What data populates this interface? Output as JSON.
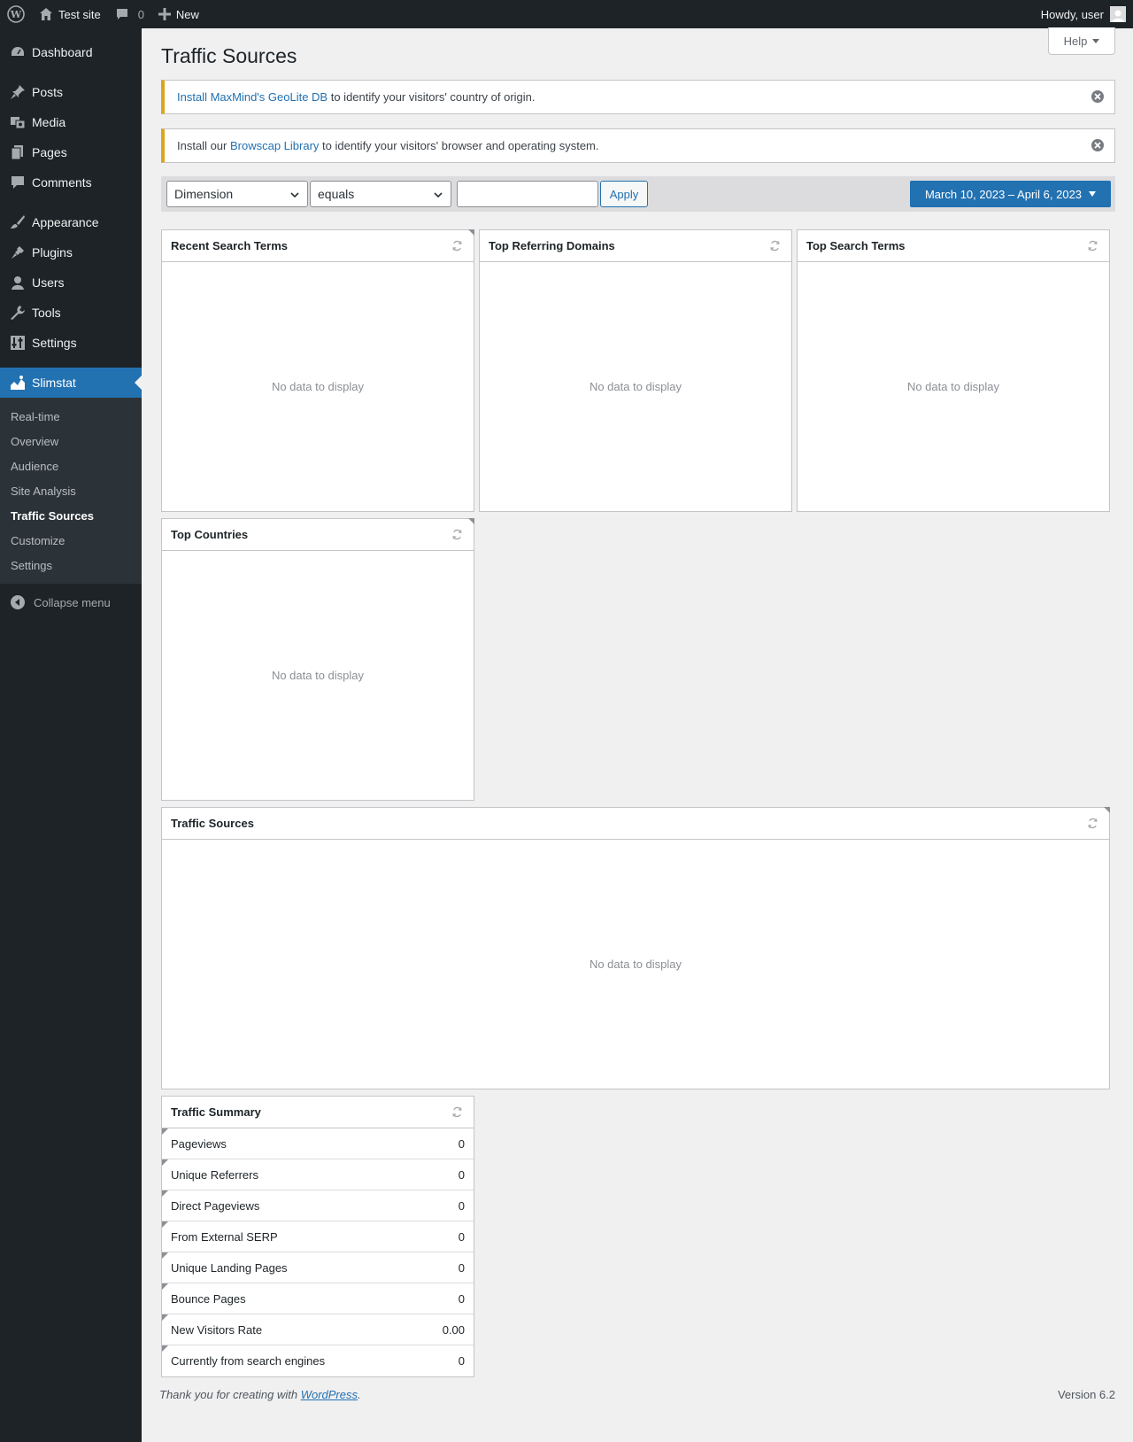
{
  "adminbar": {
    "site_name": "Test site",
    "comments_count": "0",
    "new_label": "New",
    "howdy": "Howdy, user"
  },
  "sidebar": {
    "items": [
      {
        "label": "Dashboard",
        "icon": "dashboard-icon"
      },
      {
        "label": "Posts",
        "icon": "pin-icon"
      },
      {
        "label": "Media",
        "icon": "media-icon"
      },
      {
        "label": "Pages",
        "icon": "pages-icon"
      },
      {
        "label": "Comments",
        "icon": "comment-icon"
      },
      {
        "label": "Appearance",
        "icon": "brush-icon"
      },
      {
        "label": "Plugins",
        "icon": "plug-icon"
      },
      {
        "label": "Users",
        "icon": "user-icon"
      },
      {
        "label": "Tools",
        "icon": "wrench-icon"
      },
      {
        "label": "Settings",
        "icon": "sliders-icon"
      },
      {
        "label": "Slimstat",
        "icon": "chart-area-icon"
      }
    ],
    "submenu": [
      "Real-time",
      "Overview",
      "Audience",
      "Site Analysis",
      "Traffic Sources",
      "Customize",
      "Settings"
    ],
    "collapse_label": "Collapse menu"
  },
  "main": {
    "help_label": "Help",
    "title": "Traffic Sources",
    "notice1": {
      "link": "Install MaxMind's GeoLite DB",
      "text": " to identify your visitors' country of origin."
    },
    "notice2": {
      "pre": "Install our ",
      "link": "Browscap Library",
      "text": " to identify your visitors' browser and operating system."
    },
    "filter": {
      "dimension": "Dimension",
      "operator": "equals",
      "value_placeholder": "",
      "apply": "Apply",
      "date_range": "March 10, 2023 – April 6, 2023"
    },
    "empty_text": "No data to display",
    "boxes": {
      "recent_search_terms": "Recent Search Terms",
      "top_referring_domains": "Top Referring Domains",
      "top_search_terms": "Top Search Terms",
      "top_countries": "Top Countries",
      "traffic_sources": "Traffic Sources",
      "traffic_summary": "Traffic Summary"
    },
    "summary": [
      {
        "label": "Pageviews",
        "value": "0"
      },
      {
        "label": "Unique Referrers",
        "value": "0"
      },
      {
        "label": "Direct Pageviews",
        "value": "0"
      },
      {
        "label": "From External SERP",
        "value": "0"
      },
      {
        "label": "Unique Landing Pages",
        "value": "0"
      },
      {
        "label": "Bounce Pages",
        "value": "0"
      },
      {
        "label": "New Visitors Rate",
        "value": "0.00"
      },
      {
        "label": "Currently from search engines",
        "value": "0"
      }
    ]
  },
  "footer": {
    "thanks_pre": "Thank you for creating with ",
    "thanks_link": "WordPress",
    "thanks_post": ".",
    "version": "Version 6.2"
  },
  "colors": {
    "adminbar": "#1d2327",
    "accent": "#2271b1",
    "notice_warning": "#dba617",
    "background": "#f0f0f1"
  }
}
